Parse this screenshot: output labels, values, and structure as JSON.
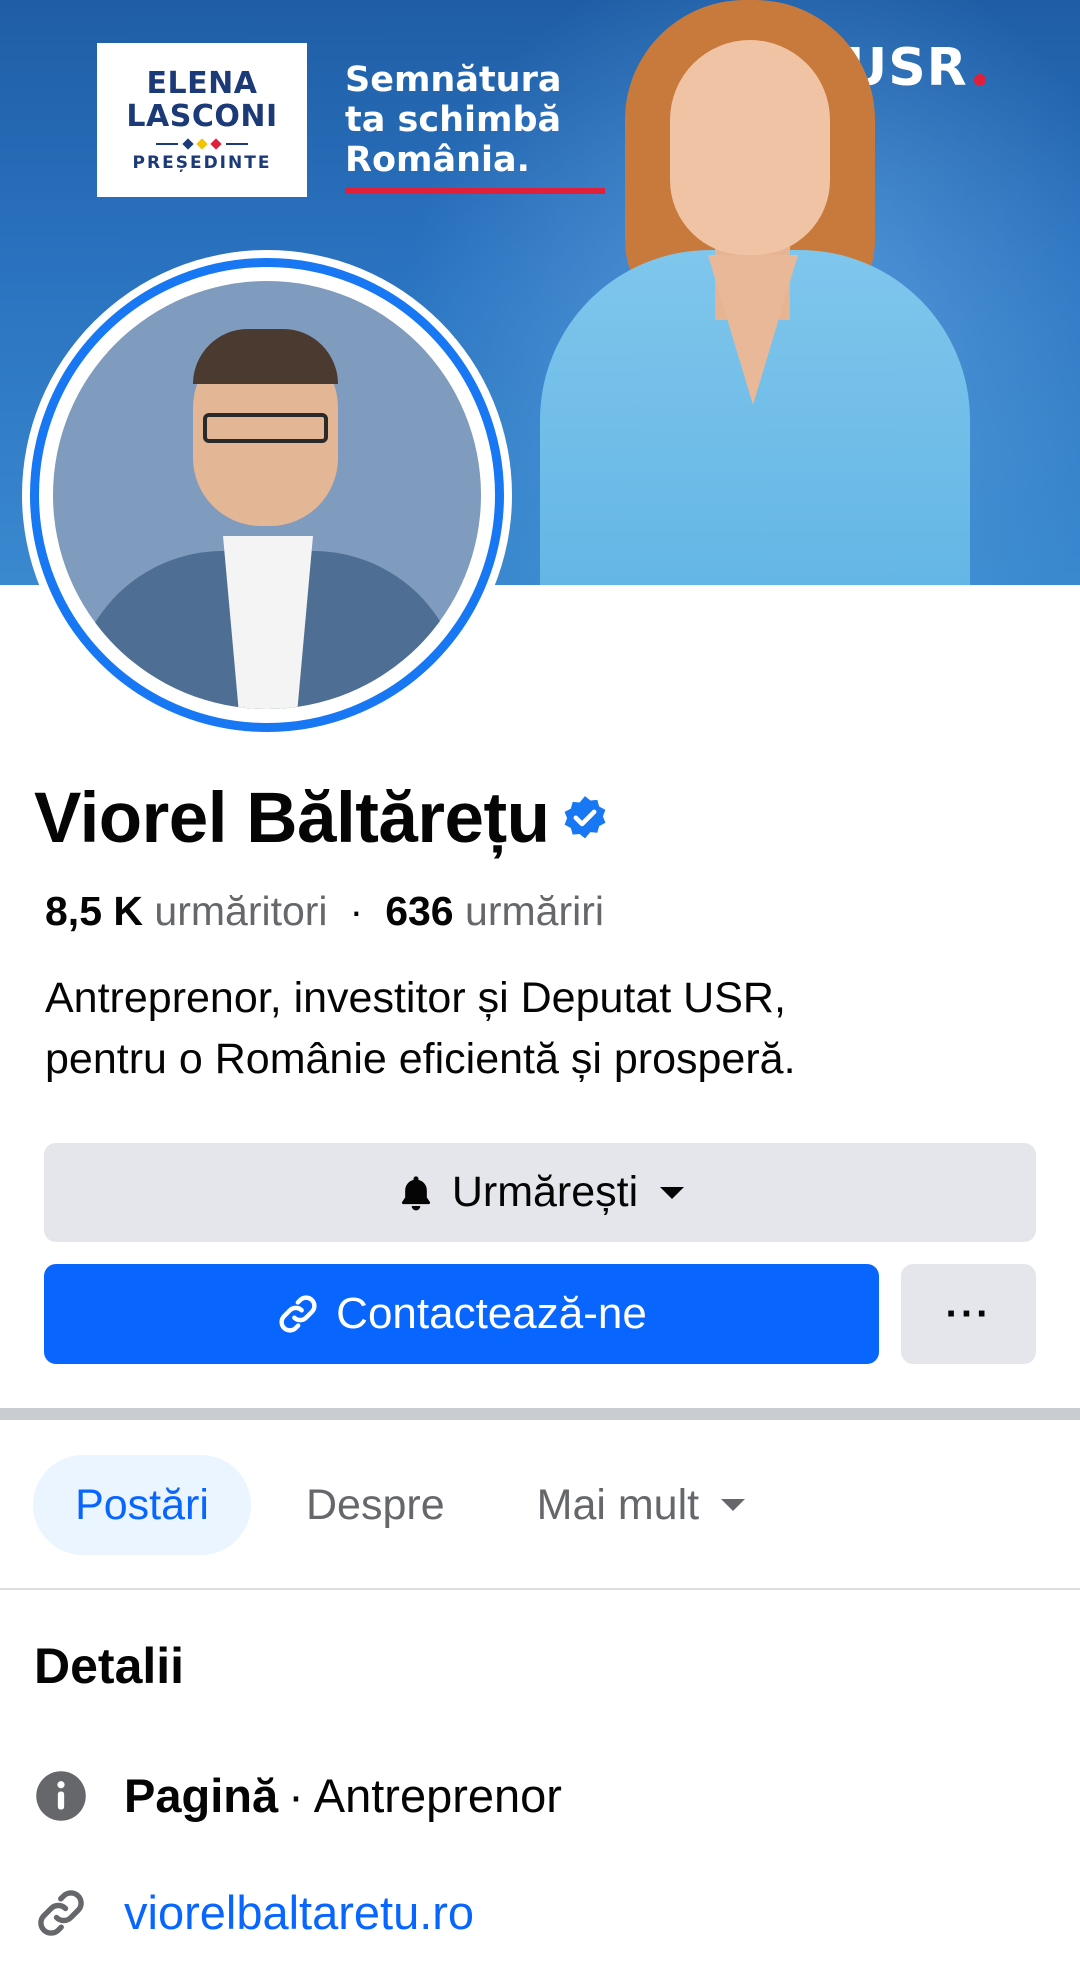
{
  "cover": {
    "badge_line1": "ELENA",
    "badge_line2": "LASCONI",
    "badge_line3": "PREȘEDINTE",
    "slogan": [
      "Semnătura",
      "ta schimbă",
      "România."
    ],
    "party": "USR",
    "colors": {
      "background": "#2a72bf",
      "accent_red": "#e0203a",
      "badge_text": "#1c3a78"
    }
  },
  "profile": {
    "name": "Viorel Băltărețu",
    "verified_icon": "verified-badge-icon",
    "followers_count": "8,5 K",
    "followers_label": "urmăritori",
    "separator": "·",
    "following_count": "636",
    "following_label": "urmăriri",
    "bio_line1": "Antreprenor, investitor și Deputat USR,",
    "bio_line2": "pentru o Românie eficientă și prosperă."
  },
  "actions": {
    "follow_label": "Urmărești",
    "follow_icon": "bell-icon",
    "contact_label": "Contactează-ne",
    "contact_icon": "link-icon",
    "more_label": "···"
  },
  "tabs": [
    {
      "label": "Postări",
      "active": true
    },
    {
      "label": "Despre",
      "active": false
    },
    {
      "label": "Mai mult",
      "active": false
    }
  ],
  "details": {
    "title": "Detalii",
    "type_label": "Pagină",
    "type_separator": "·",
    "category": "Antreprenor",
    "website": "viorelbaltaretu.ro"
  },
  "theme": {
    "primary": "#0866ff",
    "button_gray": "#e4e6eb",
    "muted_text": "#65676b"
  }
}
